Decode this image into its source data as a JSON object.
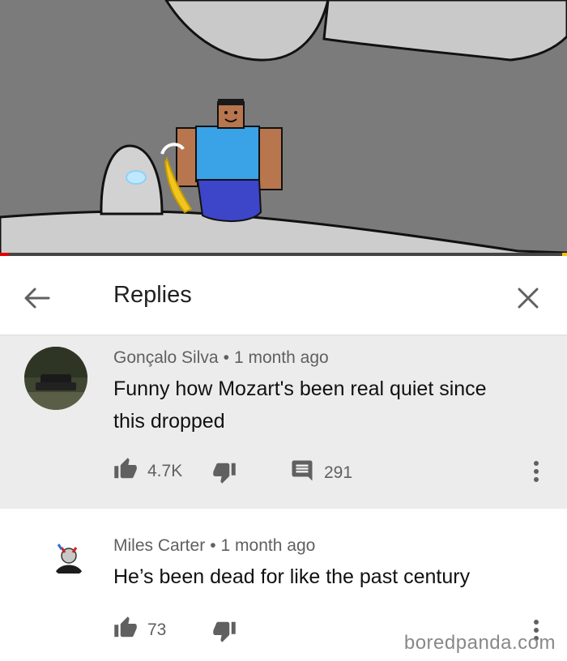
{
  "header": {
    "title": "Replies"
  },
  "top_comment": {
    "author": "Gonçalo Silva",
    "separator": "•",
    "time": "1 month ago",
    "text_line1": "Funny how Mozart's been real quiet since",
    "text_line2": "this dropped",
    "likes": "4.7K",
    "replies": "291"
  },
  "reply": {
    "author": "Miles Carter",
    "separator": "•",
    "time": "1 month ago",
    "text": "He’s been dead for like the past century",
    "likes": "73"
  },
  "watermark": "boredpanda.com",
  "video": {
    "progress": 0.015
  },
  "icons": [
    "back-arrow-icon",
    "close-icon",
    "thumbs-up-icon",
    "thumbs-down-icon",
    "reply-icon",
    "more-vert-icon"
  ],
  "colors": {
    "progress": "#e00000",
    "highlight_bg": "#ececec",
    "meta_text": "#606060"
  }
}
